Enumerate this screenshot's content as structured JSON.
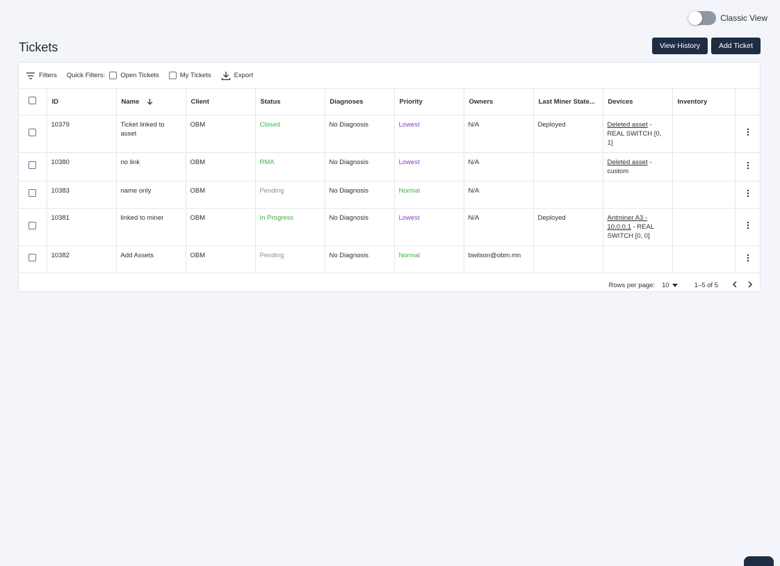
{
  "toggle": {
    "label": "Classic View",
    "on": false
  },
  "page": {
    "title": "Tickets"
  },
  "buttons": {
    "view_history": "View History",
    "add_ticket": "Add Ticket"
  },
  "toolbar": {
    "filters": "Filters",
    "quick_filters": "Quick Filters:",
    "open_tickets": "Open Tickets",
    "my_tickets": "My Tickets",
    "export": "Export"
  },
  "table": {
    "columns": [
      "ID",
      "Name",
      "Client",
      "Status",
      "Diagnoses",
      "Priority",
      "Owners",
      "Last Miner State...",
      "Devices",
      "Inventory"
    ],
    "rows": [
      {
        "id": "10379",
        "name": "Ticket linked to asset",
        "client": "OBM",
        "status": "Closed",
        "diagnoses": "No Diagnosis",
        "priority": "Lowest",
        "owners": "N/A",
        "last_state": "Deployed",
        "device_link": "Deleted asset",
        "device_rest": " - REAL SWITCH [0, 1]",
        "inventory": ""
      },
      {
        "id": "10380",
        "name": "no link",
        "client": "OBM",
        "status": "RMA",
        "diagnoses": "No Diagnosis",
        "priority": "Lowest",
        "owners": "N/A",
        "last_state": "",
        "device_link": "Deleted asset",
        "device_rest": " - custom",
        "inventory": ""
      },
      {
        "id": "10383",
        "name": "name only",
        "client": "OBM",
        "status": "Pending",
        "diagnoses": "No Diagnosis",
        "priority": "Normal",
        "owners": "N/A",
        "last_state": "",
        "device_link": "",
        "device_rest": "",
        "inventory": ""
      },
      {
        "id": "10381",
        "name": "linked to miner",
        "client": "OBM",
        "status": "In Progress",
        "diagnoses": "No Diagnosis",
        "priority": "Lowest",
        "owners": "N/A",
        "last_state": "Deployed",
        "device_link": "Antminer A3 - 10.0.0.1",
        "device_rest": " - REAL SWITCH [0, 0]",
        "inventory": ""
      },
      {
        "id": "10382",
        "name": "Add Assets",
        "client": "OBM",
        "status": "Pending",
        "diagnoses": "No Diagnosis",
        "priority": "Normal",
        "owners": "bwilson@obm.mn",
        "last_state": "",
        "device_link": "",
        "device_rest": "",
        "inventory": ""
      }
    ]
  },
  "pagination": {
    "rows_per_page_label": "Rows per page:",
    "rows_per_page": "10",
    "range": "1–5 of 5"
  },
  "colors": {
    "status_closed": "#3cb043",
    "status_rma": "#3cb043",
    "status_in_progress": "#3cb043",
    "status_pending": "#8a8f98",
    "priority_lowest": "#8e3fbf",
    "priority_normal": "#3cb043",
    "button_bg": "#1e2d44"
  }
}
